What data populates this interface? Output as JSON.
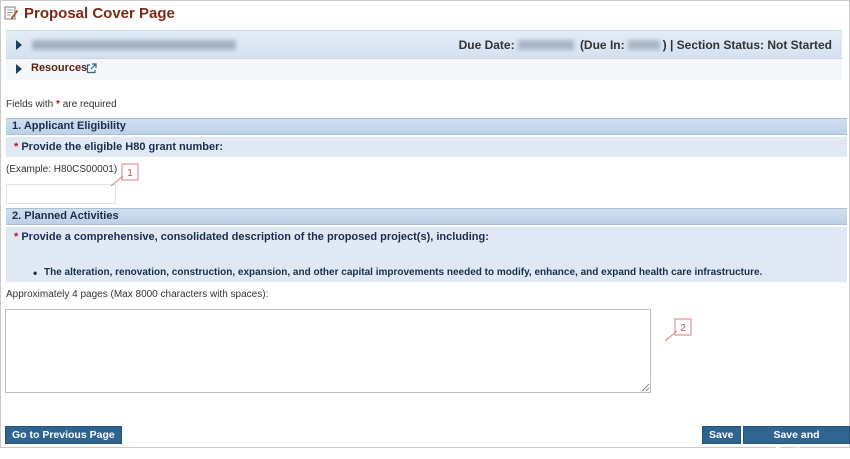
{
  "page": {
    "title": "Proposal Cover Page"
  },
  "info_bar": {
    "due_date_label": "Due Date:",
    "due_in_label": "(Due In:",
    "due_in_close": ")",
    "section_status": "| Section Status: Not Started"
  },
  "resources": {
    "label": "Resources"
  },
  "required_note": {
    "star": "*",
    "text": "are required",
    "prefix": "Fields with"
  },
  "sections": [
    {
      "heading": "1. Applicant Eligibility",
      "question": "Provide the eligible H80 grant number:",
      "example": "(Example: H80CS00001)",
      "input_value": "",
      "callout": "1"
    },
    {
      "heading": "2. Planned Activities",
      "question": "Provide a comprehensive, consolidated description of the proposed project(s), including:",
      "bullet": "The alteration, renovation, construction, expansion, and other capital improvements needed to modify, enhance, and expand health care infrastructure.",
      "note": "Approximately 4 pages (Max 8000 characters with spaces):",
      "textarea_value": "",
      "callout": "2"
    }
  ],
  "buttons": {
    "previous": "Go to Previous Page",
    "save": "Save",
    "save_continue": "Save and Continue"
  },
  "colors": {
    "title": "#7a2a17",
    "button": "#2f6491",
    "required_star": "#c01515",
    "section_header": "#bcd1e7"
  }
}
